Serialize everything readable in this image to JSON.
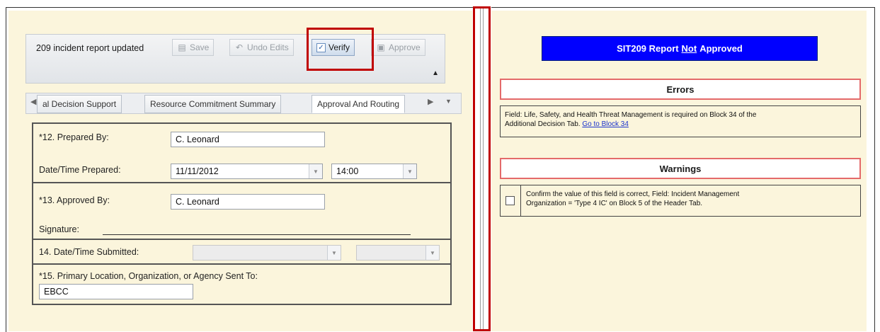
{
  "toolbar": {
    "status": "209 incident report updated",
    "save": "Save",
    "undo": "Undo Edits",
    "verify": "Verify",
    "approve": "Approve"
  },
  "tabs": {
    "partial": "al Decision Support",
    "resource": "Resource Commitment Summary",
    "approval": "Approval And Routing"
  },
  "form": {
    "prepared_by_label": "*12. Prepared By:",
    "prepared_by_value": "C. Leonard",
    "datetime_prepared_label": "Date/Time Prepared:",
    "date_prepared": "11/11/2012",
    "time_prepared": "14:00",
    "approved_by_label": "*13. Approved By:",
    "approved_by_value": "C. Leonard",
    "signature_label": "Signature:",
    "submitted_label": "14. Date/Time Submitted:",
    "primary_location_label": "*15. Primary Location, Organization, or Agency Sent To:",
    "primary_location_value": "EBCC"
  },
  "banner": {
    "pre": "SIT209 Report",
    "not": "Not",
    "post": "Approved"
  },
  "errors": {
    "title": "Errors",
    "message_line1": "Field: Life, Safety, and Health Threat Management is required on Block 34 of the",
    "message_line2": "Additional Decision Tab.",
    "link": "Go to Block 34"
  },
  "warnings": {
    "title": "Warnings",
    "message_line1": "Confirm the value of this field is correct, Field: Incident Management",
    "message_line2": "Organization = 'Type 4 IC' on Block 5 of the Header Tab."
  },
  "colors": {
    "panel_bg": "#fbf5dc",
    "banner_bg": "#0000ff",
    "highlight": "#c00000",
    "section_border": "#e46a6a"
  }
}
